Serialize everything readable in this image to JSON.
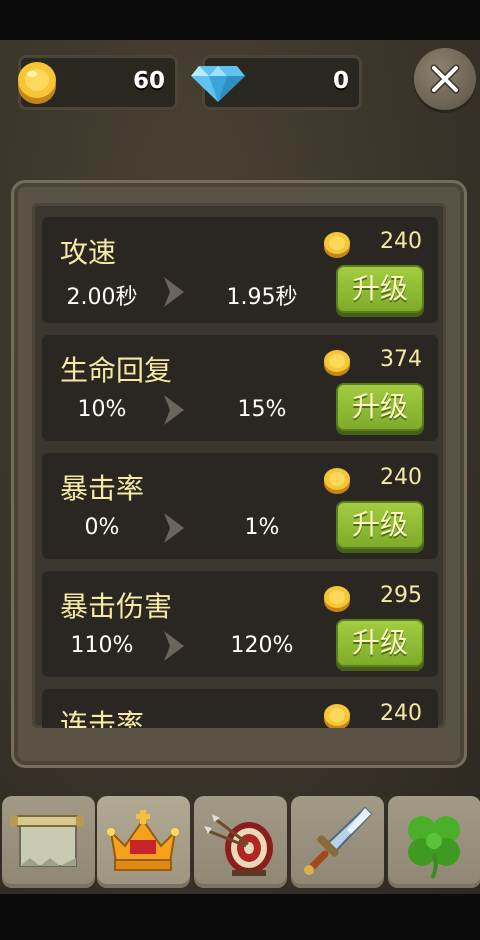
{
  "resources": {
    "coins": "60",
    "gems": "0"
  },
  "icons": {
    "coin": "coin-icon",
    "gem": "diamond-icon",
    "close": "close-icon"
  },
  "upgrades": [
    {
      "title": "攻速",
      "cost": "240",
      "current": "2.00秒",
      "next": "1.95秒",
      "button": "升级"
    },
    {
      "title": "生命回复",
      "cost": "374",
      "current": "10%",
      "next": "15%",
      "button": "升级"
    },
    {
      "title": "暴击率",
      "cost": "240",
      "current": "0%",
      "next": "1%",
      "button": "升级"
    },
    {
      "title": "暴击伤害",
      "cost": "295",
      "current": "110%",
      "next": "120%",
      "button": "升级"
    },
    {
      "title": "连击率",
      "cost": "240"
    }
  ],
  "tabs": [
    "scroll-icon",
    "crown-icon",
    "archery-target-icon",
    "sword-icon",
    "clover-icon"
  ],
  "colors": {
    "title": "#f6e9a4",
    "button_green": "#8fb833"
  }
}
